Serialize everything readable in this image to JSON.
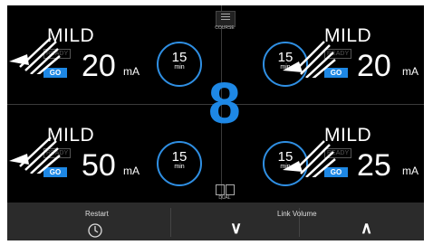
{
  "quadrants": [
    {
      "mode": "MILD",
      "status": "READY",
      "go": "GO",
      "value": "20",
      "unit": "mA",
      "timer": "15",
      "timer_unit": "min"
    },
    {
      "mode": "MILD",
      "status": "READY",
      "go": "GO",
      "value": "20",
      "unit": "mA",
      "timer": "15",
      "timer_unit": "min"
    },
    {
      "mode": "MILD",
      "status": "READY",
      "go": "GO",
      "value": "50",
      "unit": "mA",
      "timer": "15",
      "timer_unit": "min"
    },
    {
      "mode": "MILD",
      "status": "READY",
      "go": "GO",
      "value": "25",
      "unit": "mA",
      "timer": "15",
      "timer_unit": "min"
    }
  ],
  "center_number": "8",
  "course_label": "COURSE",
  "dual_label": "DUAL",
  "bottom": {
    "restart": "Restart",
    "link_volume": "Link Volume",
    "down": "∨",
    "up": "∧"
  },
  "colors": {
    "accent": "#1e88e5",
    "background": "#000000",
    "bar": "#2b2b2b"
  }
}
